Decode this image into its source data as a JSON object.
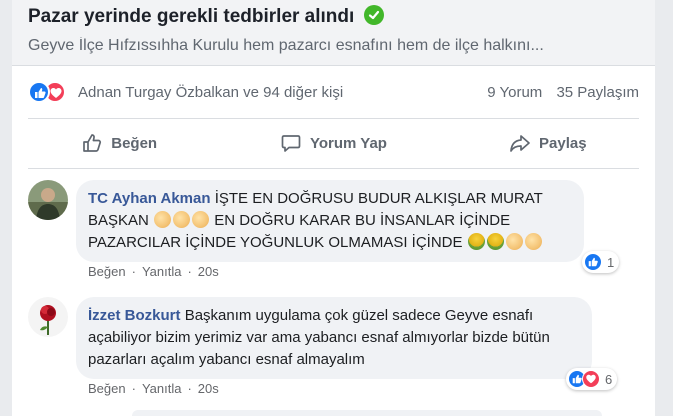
{
  "preview": {
    "title": "Pazar yerinde gerekli tedbirler alındı",
    "description": "Geyve İlçe Hıfzıssıhha Kurulu hem pazarcı esnafını hem de ilçe halkını..."
  },
  "reactions": {
    "names": "Adnan Turgay Özbalkan ve 94 diğer kişi",
    "comments": "9 Yorum",
    "shares": "35 Paylaşım"
  },
  "actions": {
    "like": "Beğen",
    "comment": "Yorum Yap",
    "share": "Paylaş"
  },
  "comments": [
    {
      "author": "TC Ayhan Akman",
      "lines": [
        "İŞTE EN DOĞRUSU BUDUR ALKIŞLAR MURAT",
        "BAŞKAN",
        "EN DOĞRU KARAR BU İNSANLAR İÇİNDE",
        "PAZARCILAR İÇİNDE YOĞUNLUK OLMAMASI İÇİNDE"
      ],
      "reaction_count": "1",
      "like": "Beğen",
      "reply": "Yanıtla",
      "time": "20s"
    },
    {
      "author": "İzzet Bozkurt",
      "lines": [
        "Başkanım uygulama çok güzel sadece Geyve esnafı",
        "açabiliyor bizim yerimiz var ama yabancı esnaf almıyorlar bizde bütün",
        "pazarları açalım yabancı esnaf almayalım"
      ],
      "reaction_count": "6",
      "like": "Beğen",
      "reply": "Yanıtla",
      "time": "20s"
    }
  ],
  "colors": {
    "like_blue": "#1877f2",
    "love_red": "#f33e58",
    "author_blue": "#385898",
    "verified_green": "#42b72a"
  }
}
